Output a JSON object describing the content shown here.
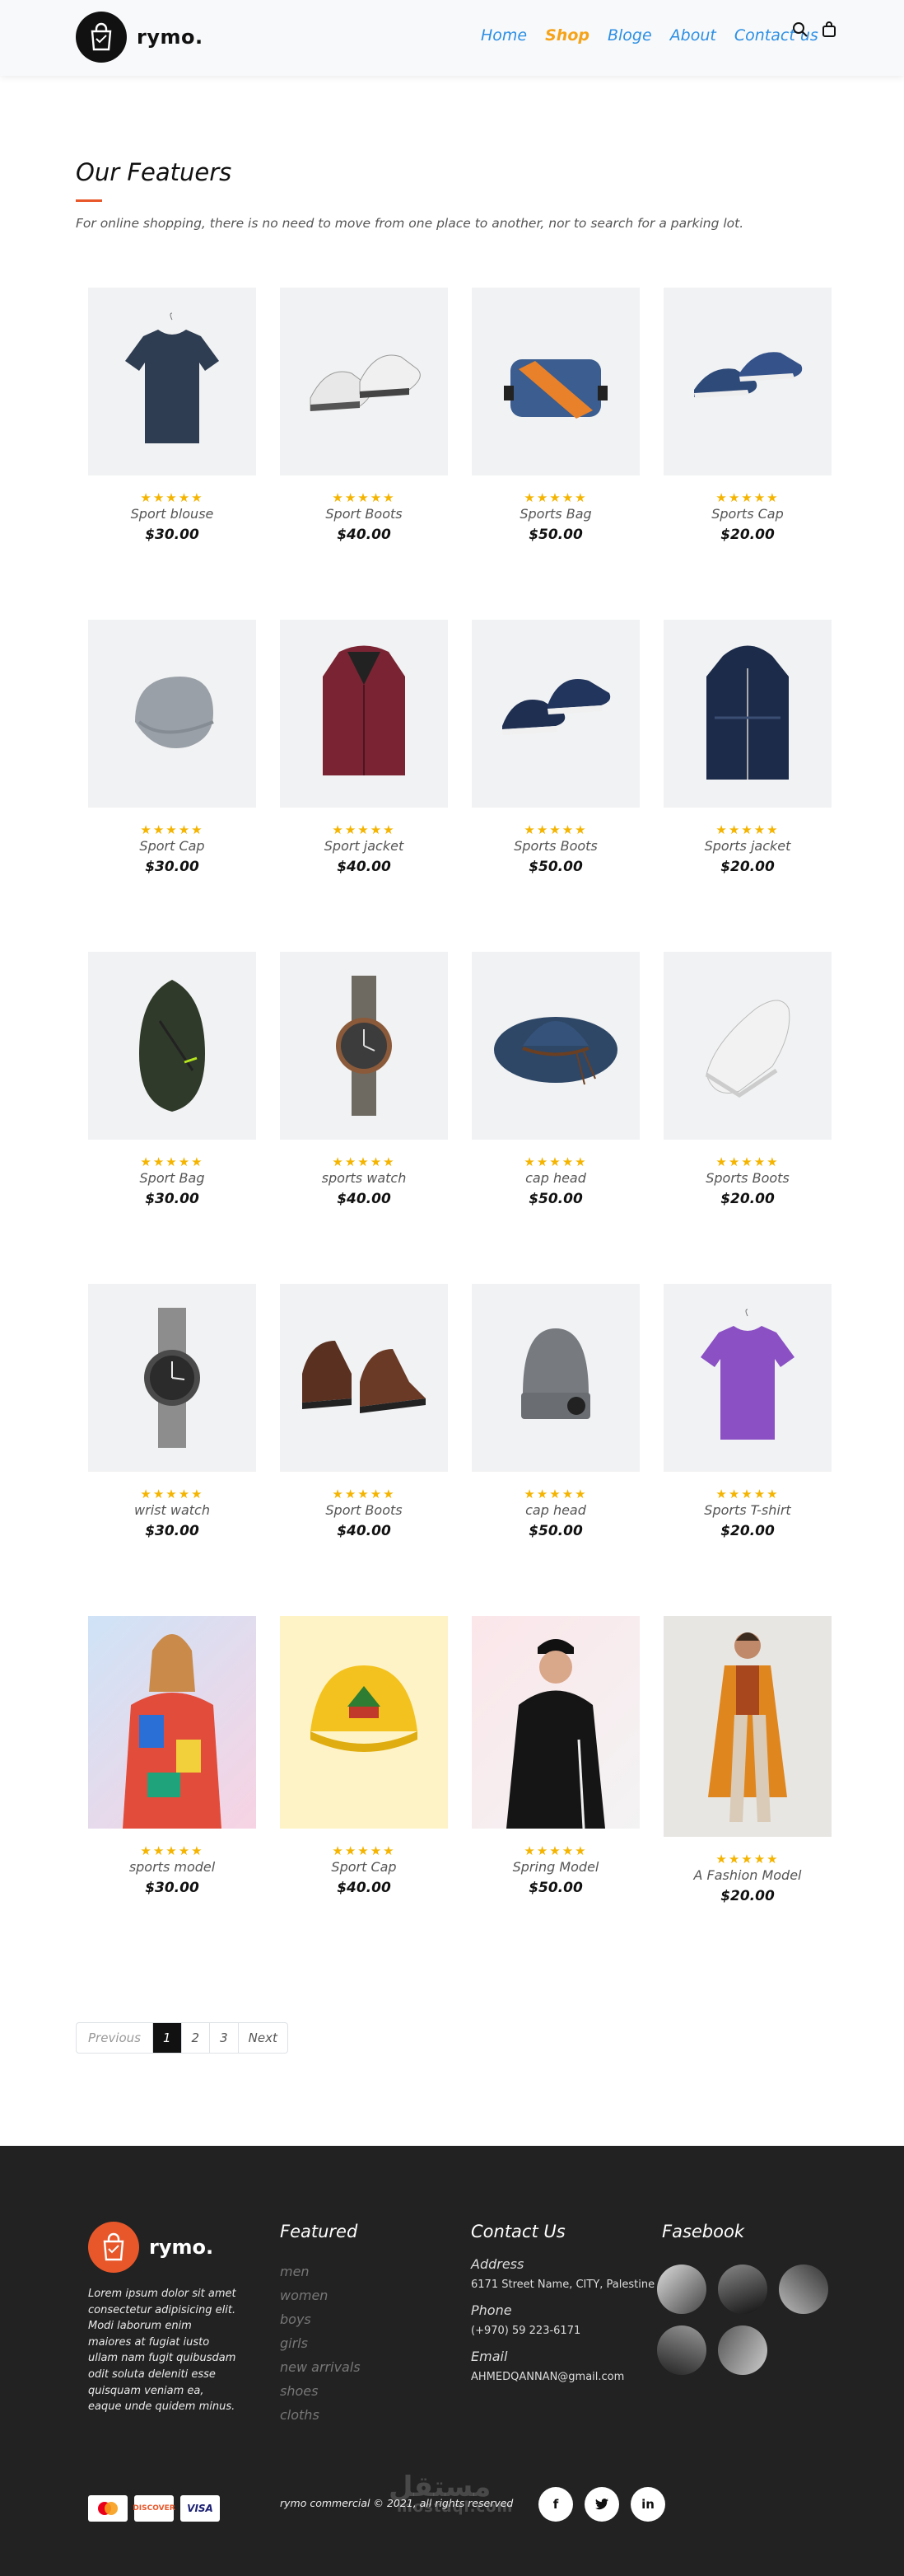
{
  "brand": {
    "name": "rymo."
  },
  "nav": {
    "links": [
      "Home",
      "Shop",
      "Bloge",
      "About",
      "Contact us"
    ],
    "active": "Shop",
    "icons": [
      "search-icon",
      "bag-icon"
    ]
  },
  "features": {
    "title": "Our Featuers",
    "subtitle": "For online shopping, there is no need to move from one place to another, nor to search for a parking lot."
  },
  "products": [
    {
      "name": "Sport blouse",
      "price": "$30.00",
      "rating": 5,
      "image": "navy-tshirt"
    },
    {
      "name": "Sport Boots",
      "price": "$40.00",
      "rating": 5,
      "image": "white-sneakers"
    },
    {
      "name": "Sports Bag",
      "price": "$50.00",
      "rating": 5,
      "image": "blue-crossbody-bag"
    },
    {
      "name": "Sports Cap",
      "price": "$20.00",
      "rating": 5,
      "image": "blue-shoes"
    },
    {
      "name": "Sport Cap",
      "price": "$30.00",
      "rating": 5,
      "image": "grey-beanie"
    },
    {
      "name": "Sport jacket",
      "price": "$40.00",
      "rating": 5,
      "image": "burgundy-jacket"
    },
    {
      "name": "Sports Boots",
      "price": "$50.00",
      "rating": 5,
      "image": "navy-sneakers"
    },
    {
      "name": "Sports jacket",
      "price": "$20.00",
      "rating": 5,
      "image": "navy-parka"
    },
    {
      "name": "Sport Bag",
      "price": "$30.00",
      "rating": 5,
      "image": "green-sling-bag"
    },
    {
      "name": "sports watch",
      "price": "$40.00",
      "rating": 5,
      "image": "grey-watch"
    },
    {
      "name": "cap head",
      "price": "$50.00",
      "rating": 5,
      "image": "navy-hat"
    },
    {
      "name": "Sports Boots",
      "price": "$20.00",
      "rating": 5,
      "image": "white-sneaker"
    },
    {
      "name": "wrist watch",
      "price": "$30.00",
      "rating": 5,
      "image": "dark-watch"
    },
    {
      "name": "Sport Boots",
      "price": "$40.00",
      "rating": 5,
      "image": "brown-boots"
    },
    {
      "name": "cap head",
      "price": "$50.00",
      "rating": 5,
      "image": "grey-beanie-cap"
    },
    {
      "name": "Sports T-shirt",
      "price": "$20.00",
      "rating": 5,
      "image": "purple-tshirt"
    },
    {
      "name": "sports model",
      "price": "$30.00",
      "rating": 5,
      "image": "model-colorful-jacket"
    },
    {
      "name": "Sport Cap",
      "price": "$40.00",
      "rating": 5,
      "image": "yellow-cap"
    },
    {
      "name": "Spring Model",
      "price": "$50.00",
      "rating": 5,
      "image": "model-black-hoodie"
    },
    {
      "name": "A Fashion Model",
      "price": "$20.00",
      "rating": 5,
      "image": "model-orange-coat"
    }
  ],
  "pagination": {
    "prev": "Previous",
    "pages": [
      "1",
      "2",
      "3"
    ],
    "current": "1",
    "next": "Next"
  },
  "footer": {
    "brand": "rymo.",
    "description": "Lorem ipsum dolor sit amet consectetur adipisicing elit. Modi laborum enim maiores at fugiat iusto ullam nam fugit quibusdam odit soluta deleniti esse quisquam veniam ea, eaque unde quidem minus.",
    "featured_title": "Featured",
    "featured_links": [
      "men",
      "women",
      "boys",
      "girls",
      "new arrivals",
      "shoes",
      "cloths"
    ],
    "contact_title": "Contact Us",
    "address_label": "Address",
    "address": "6171 Street Name, CITY, Palestine",
    "phone_label": "Phone",
    "phone": "(+970) 59 223-6171",
    "email_label": "Email",
    "email": "AHMEDQANNAN@gmail.com",
    "facebook_title": "Fasebook",
    "payments": [
      "MasterCard",
      "DISCOVER",
      "VISA"
    ],
    "copyright": "rymo commercial © 2021, all rights reserved",
    "watermark": "مستقل",
    "watermark_sub": "mostaql.com",
    "socials": [
      "f",
      "t",
      "in"
    ]
  },
  "colors": {
    "accent": "#f5a31a",
    "link": "#2c8fe4",
    "brand_orange": "#e8572a",
    "footer_bg": "#222222",
    "star": "#f4b400"
  }
}
